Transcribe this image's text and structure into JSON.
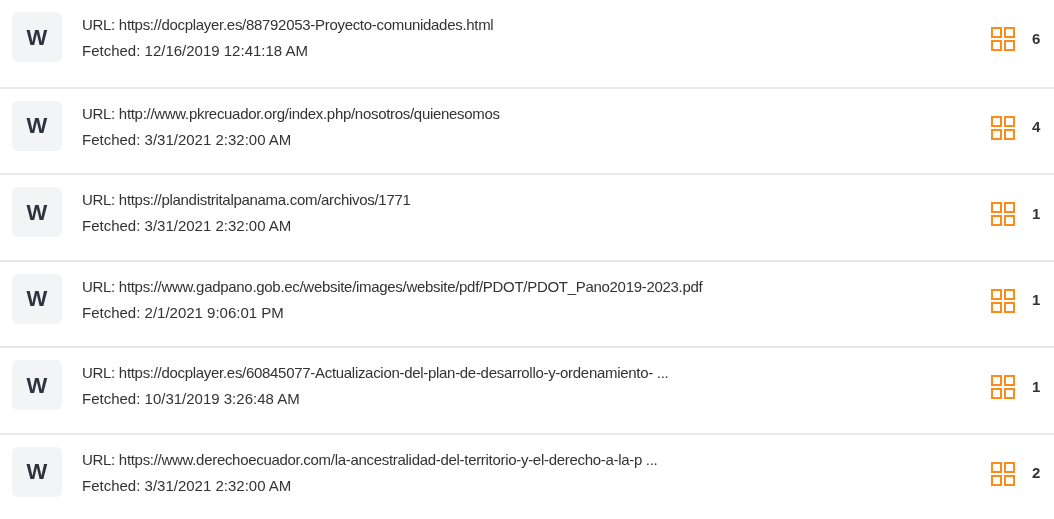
{
  "results": [
    {
      "logo": "W",
      "url": "URL: https://docplayer.es/88792053-Proyecto-comunidades.html",
      "fetched": "Fetched: 12/16/2019 12:41:18 AM",
      "count": "6"
    },
    {
      "logo": "W",
      "url": "URL: http://www.pkrecuador.org/index.php/nosotros/quienesomos",
      "fetched": "Fetched: 3/31/2021 2:32:00 AM",
      "count": "4"
    },
    {
      "logo": "W",
      "url": "URL: https://plandistritalpanama.com/archivos/1771",
      "fetched": "Fetched: 3/31/2021 2:32:00 AM",
      "count": "1"
    },
    {
      "logo": "W",
      "url": "URL: https://www.gadpano.gob.ec/website/images/website/pdf/PDOT/PDOT_Pano2019-2023.pdf",
      "fetched": "Fetched: 2/1/2021 9:06:01 PM",
      "count": "1"
    },
    {
      "logo": "W",
      "url": "URL: https://docplayer.es/60845077-Actualizacion-del-plan-de-desarrollo-y-ordenamiento- ...",
      "fetched": "Fetched: 10/31/2019 3:26:48 AM",
      "count": "1"
    },
    {
      "logo": "W",
      "url": "URL: https://www.derechoecuador.com/la-ancestralidad-del-territorio-y-el-derecho-a-la-p ...",
      "fetched": "Fetched: 3/31/2021 2:32:00 AM",
      "count": "2"
    }
  ]
}
